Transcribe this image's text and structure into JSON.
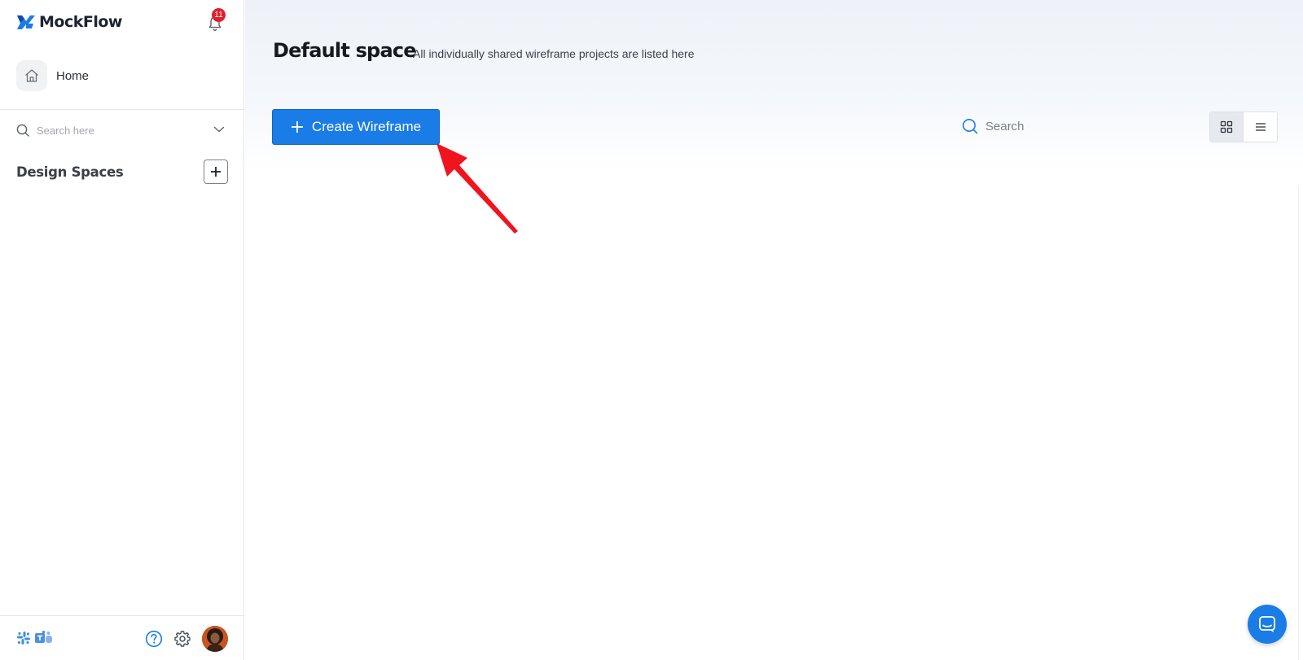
{
  "brand": {
    "name": "MockFlow",
    "accent": "#1a7ce6"
  },
  "notifications": {
    "count": "11"
  },
  "sidebar": {
    "home_label": "Home",
    "search_placeholder": "Search here",
    "spaces_title": "Design Spaces"
  },
  "main": {
    "title": "Default space",
    "subtitle": "All individually shared wireframe projects are listed here",
    "create_button_label": "Create Wireframe",
    "search_placeholder": "Search"
  },
  "icons": {
    "bell": "bell-icon",
    "home": "home-icon",
    "search": "search-icon",
    "chevron": "chevron-down-icon",
    "plus": "plus-icon",
    "grid": "grid-view-icon",
    "list": "list-view-icon",
    "help": "help-icon",
    "settings": "gear-icon",
    "chat": "chat-icon"
  }
}
